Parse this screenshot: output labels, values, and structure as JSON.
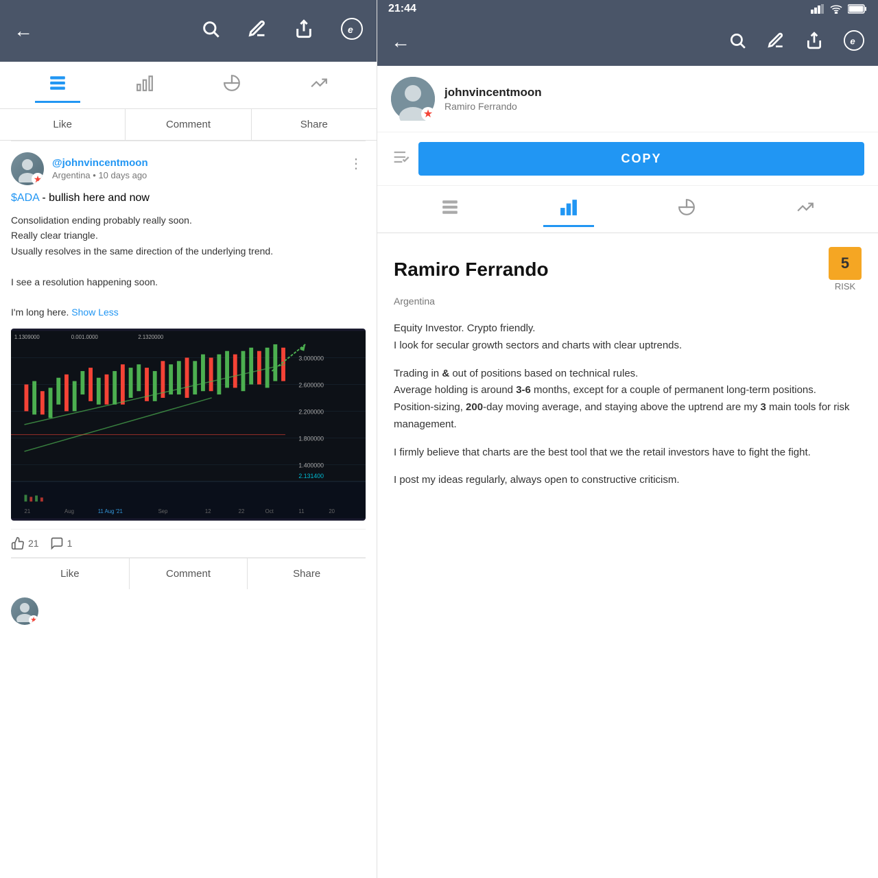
{
  "left": {
    "header": {
      "back_icon": "←",
      "search_icon": "🔍",
      "edit_icon": "✏️",
      "share_icon": "⬆",
      "logo_icon": "ⓔ"
    },
    "tabs": [
      {
        "label": "feed",
        "icon": "▤",
        "active": true
      },
      {
        "label": "chart",
        "icon": "📊"
      },
      {
        "label": "pie",
        "icon": "◑"
      },
      {
        "label": "trend",
        "icon": "↗"
      }
    ],
    "action_bar": {
      "like": "Like",
      "comment": "Comment",
      "share": "Share"
    },
    "post": {
      "username": "@johnvincentmoon",
      "country": "Argentina",
      "time_ago": "10 days ago",
      "ticker": "$ADA",
      "title_suffix": "- bullish here and now",
      "body_lines": [
        "Consolidation ending probably really soon.",
        "Really clear triangle.",
        "Usually resolves in the same direction of the underlying trend.",
        "",
        "I see a resolution happening soon.",
        "",
        "I'm long here."
      ],
      "show_less": "Show Less",
      "likes_count": "21",
      "comments_count": "1"
    },
    "bottom_bar": {
      "like": "Like",
      "comment": "Comment",
      "share": "Share"
    }
  },
  "right": {
    "status_bar": {
      "time": "21:44",
      "signal": "▌▌▌",
      "wifi": "WiFi",
      "battery": "🔋"
    },
    "header": {
      "back_icon": "←",
      "search_icon": "🔍",
      "edit_icon": "✏️",
      "share_icon": "⬆",
      "logo_icon": "ⓔ"
    },
    "profile": {
      "username": "johnvincentmoon",
      "real_name": "Ramiro Ferrando"
    },
    "copy_button": "COPY",
    "tabs": [
      {
        "label": "feed",
        "icon": "▤"
      },
      {
        "label": "chart",
        "icon": "📊",
        "active": true
      },
      {
        "label": "pie",
        "icon": "◑"
      },
      {
        "label": "trend",
        "icon": "↗"
      }
    ],
    "trader": {
      "name": "Ramiro  Ferrando",
      "country": "Argentina",
      "risk_number": "5",
      "risk_label": "RISK",
      "bio": [
        "Equity Investor. Crypto friendly.",
        "I look for secular growth sectors and charts with clear uptrends.",
        "",
        "Trading in & out of positions based on technical rules.",
        "Average holding is around 3-6 months, except for a couple of permanent long-term positions.",
        "Position-sizing,  200-day moving average, and staying above the uptrend are my 3 main tools for risk management.",
        "",
        "I firmly believe that charts are the best tool that we the retail investors have to fight the fight.",
        "",
        "I post my ideas regularly, always open to constructive criticism."
      ]
    }
  }
}
